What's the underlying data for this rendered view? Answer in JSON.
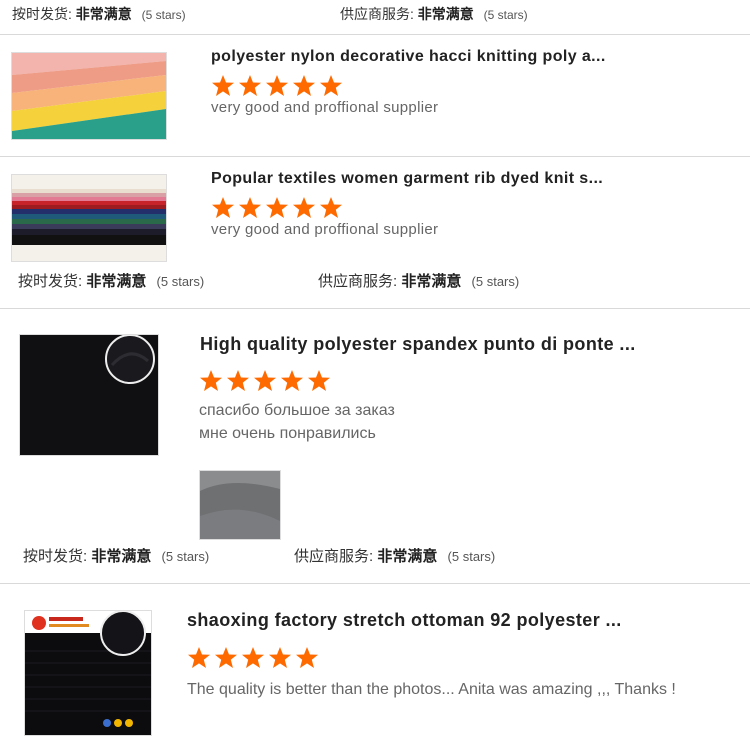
{
  "top_rating": {
    "ship_label": "按时发货:",
    "ship_value": "非常满意",
    "ship_count": "(5 stars)",
    "service_label": "供应商服务:",
    "service_value": "非常满意",
    "service_count": "(5 stars)"
  },
  "reviews": [
    {
      "title": "polyester nylon decorative hacci knitting poly a...",
      "stars": 5,
      "comment": "very good and proffional supplier",
      "image_icon": "fabric-swatches-pastel"
    },
    {
      "title": "Popular textiles women garment rib dyed knit s...",
      "stars": 5,
      "comment": "very good and proffional supplier",
      "image_icon": "fabric-swatches-multicolor",
      "rating": {
        "ship_label": "按时发货:",
        "ship_value": "非常满意",
        "ship_count": "(5 stars)",
        "service_label": "供应商服务:",
        "service_value": "非常满意",
        "service_count": "(5 stars)"
      }
    },
    {
      "title": "High quality polyester spandex punto di ponte ...",
      "stars": 5,
      "comment_line1": "спасибо большое за заказ",
      "comment_line2": "мне очень понравились",
      "image_icon": "black-fabric",
      "attachment_icon": "grey-fabric-photo",
      "rating": {
        "ship_label": "按时发货:",
        "ship_value": "非常满意",
        "ship_count": "(5 stars)",
        "service_label": "供应商服务:",
        "service_value": "非常满意",
        "service_count": "(5 stars)"
      }
    },
    {
      "title": "shaoxing factory stretch ottoman 92 polyester ...",
      "stars": 5,
      "comment": "The quality is better than the photos... Anita was amazing ,,, Thanks !",
      "image_icon": "black-ottoman-fabric"
    }
  ],
  "colors": {
    "star": "#ff6a00",
    "divider": "#d9d9d9",
    "title": "#222222",
    "comment": "#666666"
  }
}
